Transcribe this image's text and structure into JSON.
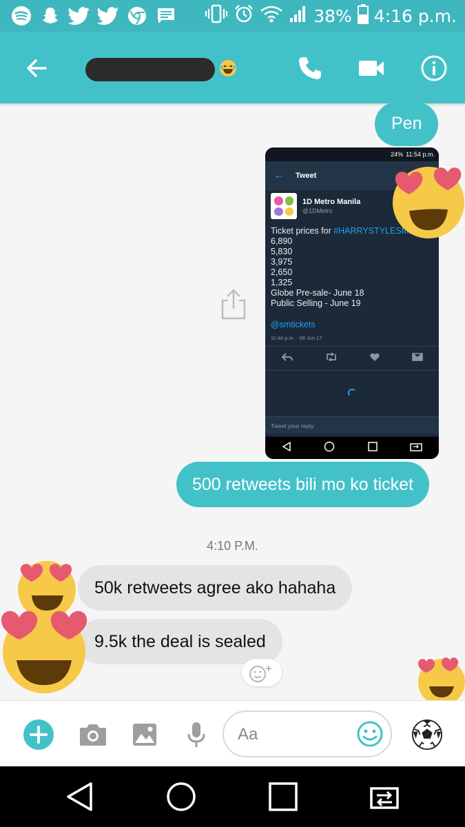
{
  "status_bar": {
    "icons": [
      "spotify-icon",
      "snapchat-icon",
      "twitter-icon",
      "twitter-icon",
      "chrome-icon",
      "message-icon"
    ],
    "right_icons": [
      "vibrate-icon",
      "alarm-icon",
      "wifi-icon",
      "signal-icon",
      "battery-icon"
    ],
    "battery": "38%",
    "time": "4:16 p.m."
  },
  "app_bar": {
    "back_icon": "arrow-left-icon",
    "contact_name_redacted": true,
    "name_emoji": "laughing-emoji",
    "actions": [
      "phone-icon",
      "video-camera-icon",
      "info-icon"
    ],
    "color": "#43c1c9"
  },
  "messages": {
    "out_1": "Pen",
    "out_3": "500 retweets bili mo ko ticket",
    "timestamp": "4:10 P.M.",
    "in_1": "50k retweets agree ako hahaha",
    "in_2": "9.5k the deal is sealed"
  },
  "tweet_screenshot": {
    "status_battery": "24%",
    "status_time": "11:54 p.m.",
    "header": "Tweet",
    "account_name": "1D Metro Manila",
    "account_handle": "@1DMetro",
    "text_prefix": "Ticket prices for ",
    "hashtag": "#HARRYSTYLESMNL",
    "lines": "6,890\n5,830\n3,975\n2,650\n1,325\nGlobe Pre-sale- June 18\nPublic Selling - June 19",
    "mention": "@smtickets",
    "date": "11:46 p.m. · 08 Jun 17",
    "reply_placeholder": "Tweet your reply"
  },
  "composer": {
    "placeholder": "Aa",
    "icons": [
      "add-icon",
      "camera-icon",
      "gallery-icon",
      "microphone-icon",
      "smiley-icon",
      "soccer-ball-icon"
    ]
  },
  "colors": {
    "accent": "#43c1c9",
    "outgoing": "#43c1c9",
    "incoming": "#e4e4e4"
  }
}
